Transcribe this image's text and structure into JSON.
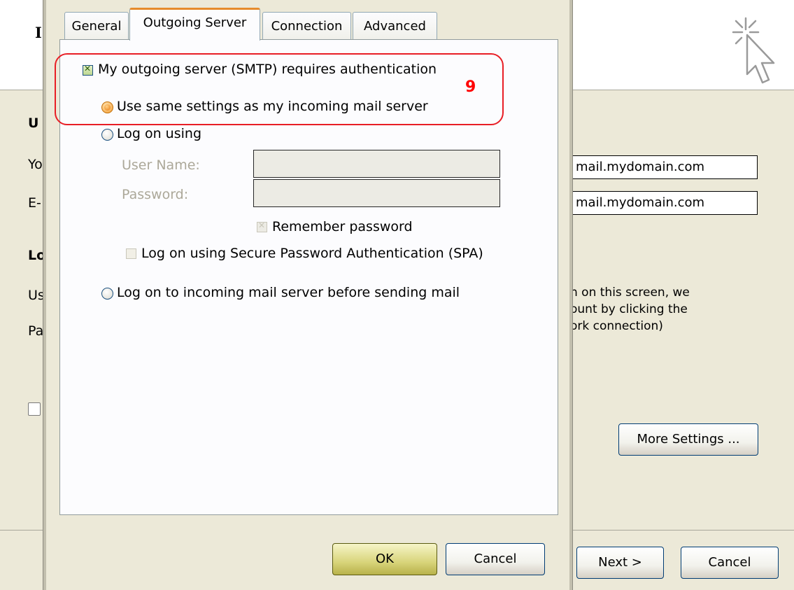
{
  "background_window": {
    "header_letter": "I",
    "section_heading_1": "U",
    "label_your": "Yo",
    "label_email": "E-",
    "section_heading_2": "Lo",
    "label_user": "Us",
    "label_password": "Pa",
    "incoming_server_value": "mail.mydomain.com",
    "outgoing_server_value": "mail.mydomain.com",
    "info_text_line1": "n on this screen, we",
    "info_text_line2": "ount by clicking the",
    "info_text_line3": "ork connection)",
    "more_settings_label": "More Settings ...",
    "next_label": "Next >",
    "cancel_label": "Cancel"
  },
  "dialog": {
    "tabs": [
      {
        "label": "General",
        "active": false
      },
      {
        "label": "Outgoing Server",
        "active": true
      },
      {
        "label": "Connection",
        "active": false
      },
      {
        "label": "Advanced",
        "active": false
      }
    ],
    "smtp_auth_label": "My outgoing server (SMTP) requires authentication",
    "smtp_auth_checked": true,
    "use_same_settings_label": "Use same settings as my incoming mail server",
    "log_on_using_label": "Log on using",
    "user_name_label": "User Name:",
    "password_label": "Password:",
    "user_name_value": "",
    "password_value": "",
    "remember_password_label": "Remember password",
    "spa_label": "Log on using Secure Password Authentication (SPA)",
    "log_on_incoming_label": "Log on to incoming mail server before sending mail",
    "ok_label": "OK",
    "cancel_label": "Cancel"
  },
  "annotation": {
    "step_number": "9",
    "color": "#e81e25"
  },
  "colors": {
    "window_bg": "#ece9d8",
    "panel_bg": "#fcfcfe",
    "active_tab_accent": "#e68b2c",
    "ok_button": "#d8d47a"
  }
}
